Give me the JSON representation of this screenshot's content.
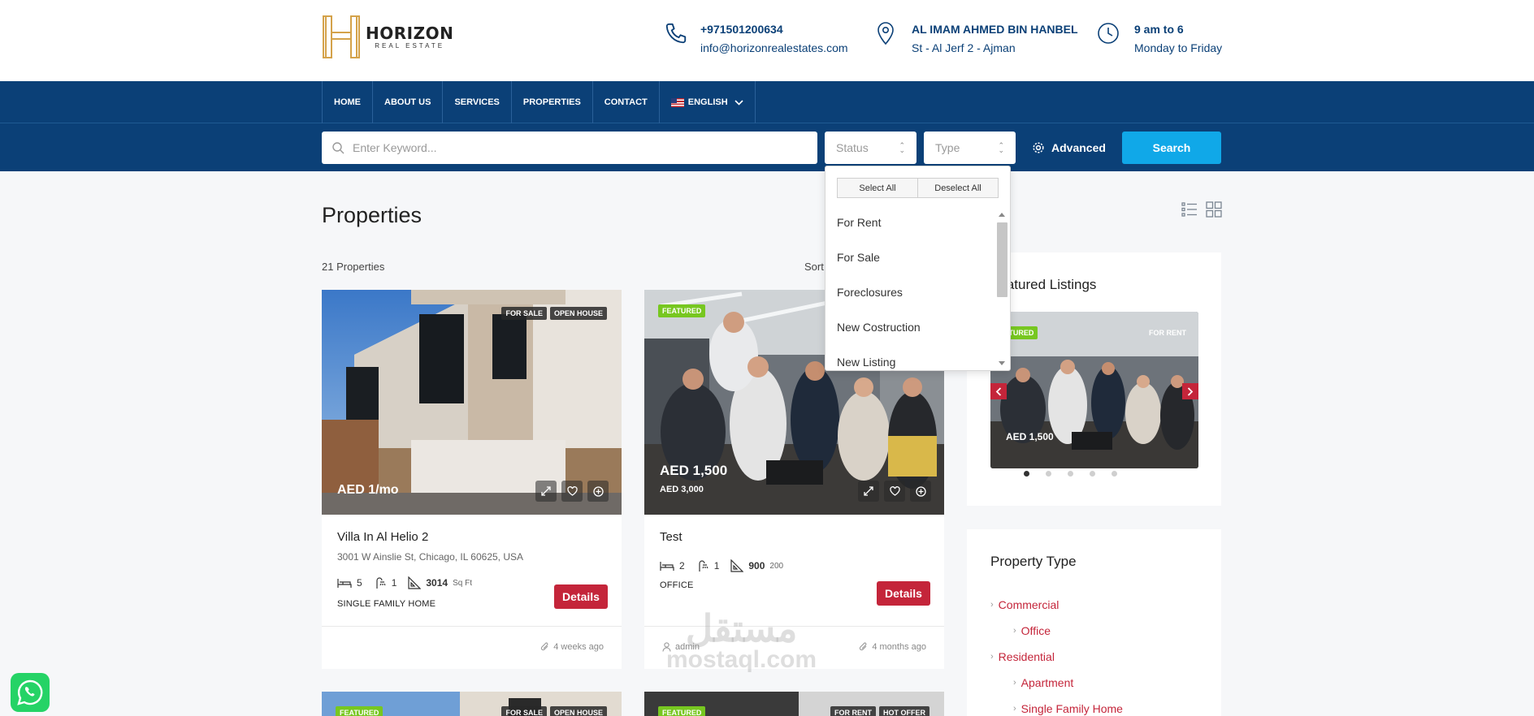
{
  "header": {
    "logo": {
      "name": "HORIZON",
      "sub": "REAL ESTATE"
    },
    "phone": "+971501200634",
    "email": "info@horizonrealestates.com",
    "address_line1": "AL IMAM AHMED BIN HANBEL",
    "address_line2": "St - Al Jerf 2 - Ajman",
    "hours_line1": "9 am to 6",
    "hours_line2": "Monday to Friday"
  },
  "nav": {
    "items": [
      "HOME",
      "ABOUT US",
      "SERVICES",
      "PROPERTIES",
      "CONTACT"
    ],
    "language": "ENGLISH"
  },
  "search": {
    "keyword_placeholder": "Enter Keyword...",
    "status_placeholder": "Status",
    "type_placeholder": "Type",
    "advanced_label": "Advanced",
    "search_label": "Search"
  },
  "status_dropdown": {
    "select_all": "Select All",
    "deselect_all": "Deselect All",
    "options": [
      "For Rent",
      "For Sale",
      "Foreclosures",
      "New Costruction",
      "New Listing"
    ]
  },
  "main": {
    "title": "Properties",
    "count": "21 Properties",
    "sort_label": "Sort"
  },
  "cards": [
    {
      "badges": [
        "FOR SALE",
        "OPEN HOUSE"
      ],
      "price": "AED 1/mo",
      "title": "Villa In Al Helio 2",
      "address": "3001 W Ainslie St, Chicago, IL 60625, USA",
      "beds": "5",
      "baths": "1",
      "area": "3014",
      "area_unit": "Sq Ft",
      "type": "SINGLE FAMILY HOME",
      "details_label": "Details",
      "time": "4 weeks ago"
    },
    {
      "badges": [
        "FEATURED"
      ],
      "price": "AED 1,500",
      "old_price": "AED 3,000",
      "title": "Test",
      "beds": "2",
      "baths": "1",
      "area": "900",
      "area_unit": "200",
      "type": "OFFICE",
      "details_label": "Details",
      "author": "admin",
      "time": "4 months ago"
    }
  ],
  "row2_badges": {
    "left": [
      "FEATURED",
      "FOR SALE",
      "OPEN HOUSE"
    ],
    "right": [
      "FEATURED",
      "FOR RENT",
      "HOT OFFER"
    ]
  },
  "featured": {
    "title": "Featured Listings",
    "badge_featured": "FEATURED",
    "badge_status": "FOR RENT",
    "price": "AED 1,500",
    "active_dot": 1,
    "dots": 5
  },
  "property_type": {
    "title": "Property Type",
    "items": [
      {
        "label": "Commercial",
        "level": 0
      },
      {
        "label": "Office",
        "level": 1
      },
      {
        "label": "Residential",
        "level": 0
      },
      {
        "label": "Apartment",
        "level": 1
      },
      {
        "label": "Single Family Home",
        "level": 1
      }
    ]
  },
  "watermark": {
    "arabic": "مستقل",
    "latin": "mostaql.com"
  },
  "colors": {
    "navy": "#0b4077",
    "accent_blue": "#10a8e8",
    "red": "#c4253a",
    "green_badge": "#77c720"
  }
}
